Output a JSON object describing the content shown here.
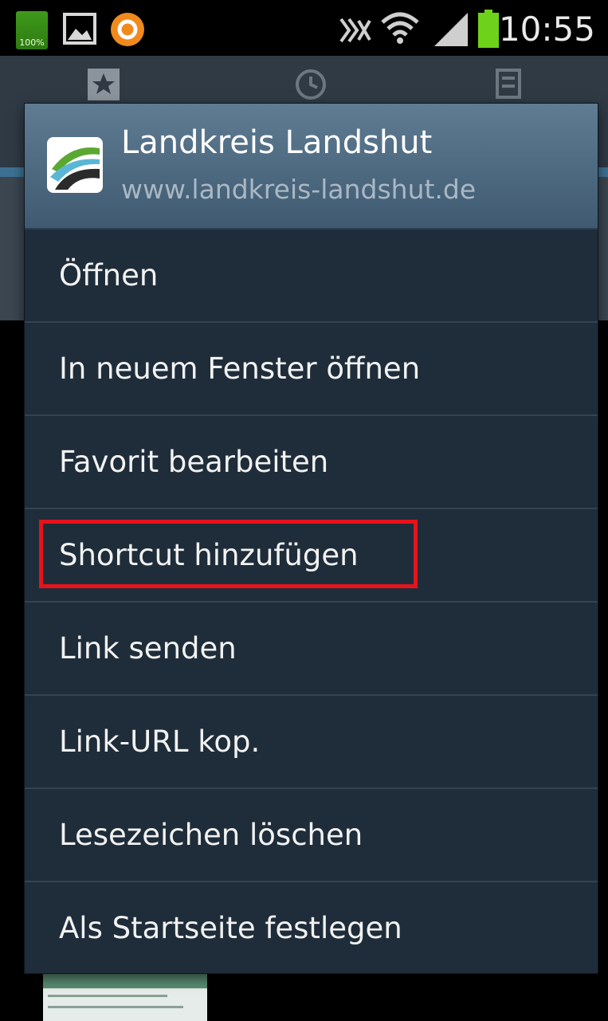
{
  "status_bar": {
    "battery_left_label": "100%",
    "time": "10:55",
    "icons": [
      "battery-icon",
      "image-icon",
      "app-circle-icon",
      "nfc-icon",
      "wifi-icon",
      "signal-icon",
      "battery-icon"
    ]
  },
  "context_menu": {
    "site_title": "Landkreis Landshut",
    "site_url": "www.landkreis-landshut.de",
    "items": [
      {
        "label": "Öffnen"
      },
      {
        "label": "In neuem Fenster öffnen"
      },
      {
        "label": "Favorit bearbeiten"
      },
      {
        "label": "Shortcut hinzufügen",
        "highlighted": true
      },
      {
        "label": "Link senden"
      },
      {
        "label": "Link-URL kop."
      },
      {
        "label": "Lesezeichen löschen"
      },
      {
        "label": "Als Startseite festlegen"
      }
    ]
  },
  "colors": {
    "highlight": "#e8121b",
    "dialog_background": "#1f2d3a",
    "header_background": "#4f6b82"
  }
}
